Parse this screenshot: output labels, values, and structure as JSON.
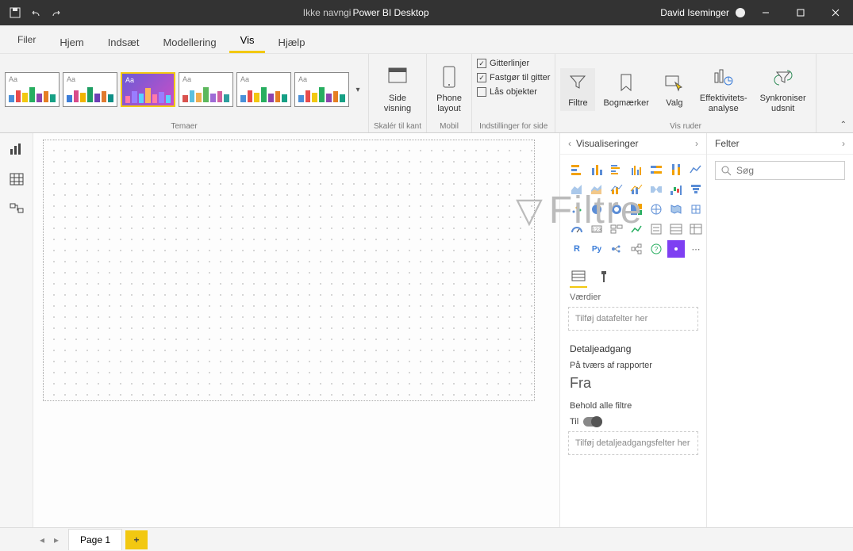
{
  "titlebar": {
    "unsaved": "Ikke navngi",
    "app": "Power BI Desktop",
    "user": "David Iseminger"
  },
  "tabs": {
    "file": "Filer",
    "home": "Hjem",
    "insert": "Indsæt",
    "modeling": "Modellering",
    "view": "Vis",
    "help": "Hjælp"
  },
  "ribbon": {
    "themes_label": "Temaer",
    "page_view": "Side\nvisning",
    "scale_label": "Skalér til kant",
    "phone_layout": "Phone\nlayout",
    "mobile_label": "Mobil",
    "gridlines": "Gitterlinjer",
    "snap": "Fastgør til gitter",
    "lock": "Lås objekter",
    "page_options_label": "Indstillinger for side",
    "filters": "Filtre",
    "bookmarks": "Bogmærker",
    "selection": "Valg",
    "perf": "Effektivitets-\nanalyse",
    "sync": "Synkroniser\nudsnit",
    "show_panes_label": "Vis ruder"
  },
  "overlay": {
    "filtre": "Filtre"
  },
  "viz_pane": {
    "title": "Visualiseringer",
    "values": "Værdier",
    "drop1": "Tilføj datafelter her",
    "drill": "Detaljeadgang",
    "cross": "På tværs af rapporter",
    "off": "Fra",
    "keep": "Behold alle filtre",
    "on": "Til",
    "drop2": "Tilføj detaljeadgangsfelter her"
  },
  "fields_pane": {
    "title": "Felter",
    "search_placeholder": "Søg"
  },
  "pages": {
    "page1": "Page 1"
  }
}
